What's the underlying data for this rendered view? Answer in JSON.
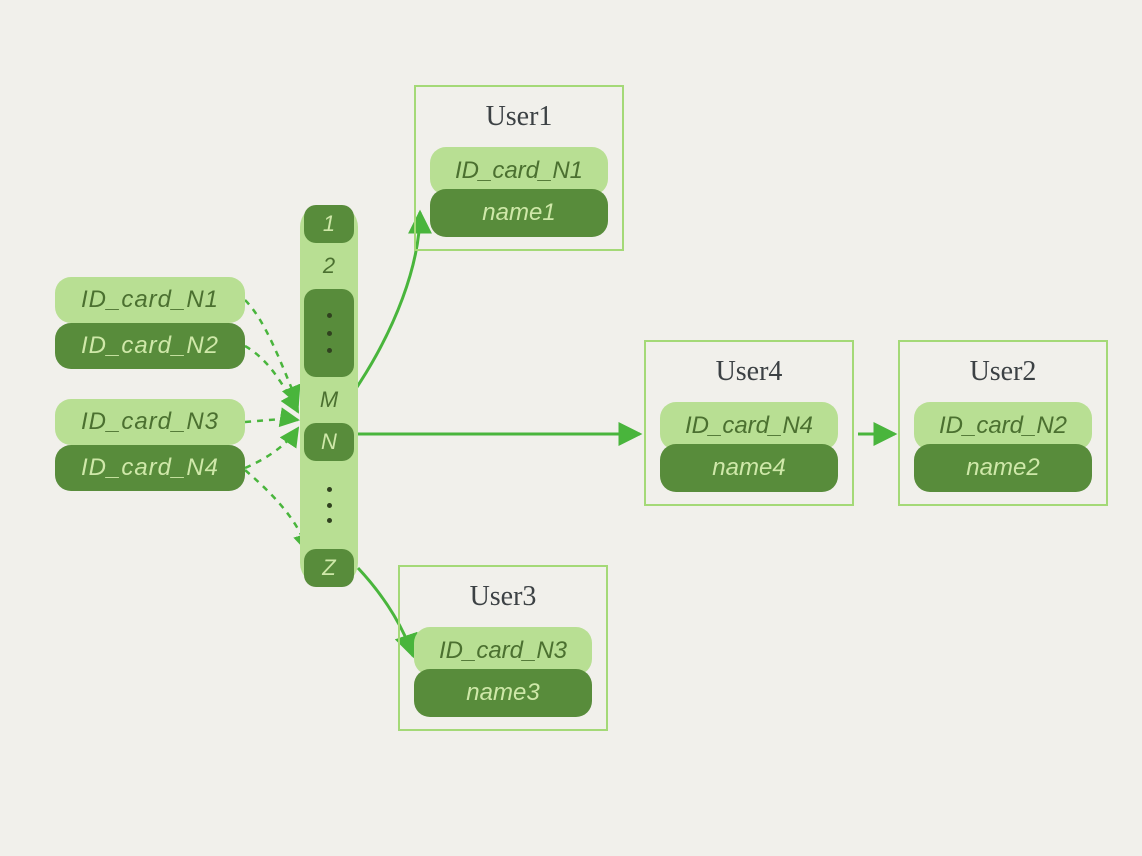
{
  "id_inputs": {
    "items": [
      "ID_card_N1",
      "ID_card_N2",
      "ID_card_N3",
      "ID_card_N4"
    ]
  },
  "hash_column": {
    "slots": [
      "1",
      "2",
      "M",
      "N",
      "Z"
    ]
  },
  "users": {
    "user1": {
      "title": "User1",
      "id": "ID_card_N1",
      "name": "name1"
    },
    "user2": {
      "title": "User2",
      "id": "ID_card_N2",
      "name": "name2"
    },
    "user3": {
      "title": "User3",
      "id": "ID_card_N3",
      "name": "name3"
    },
    "user4": {
      "title": "User4",
      "id": "ID_card_N4",
      "name": "name4"
    }
  },
  "colors": {
    "bg": "#f1f0eb",
    "pill_light": "#b8df93",
    "pill_dark": "#588c3b",
    "card_border": "#a4d977",
    "arrow": "#49b53c",
    "text_dark": "#3c4144"
  }
}
